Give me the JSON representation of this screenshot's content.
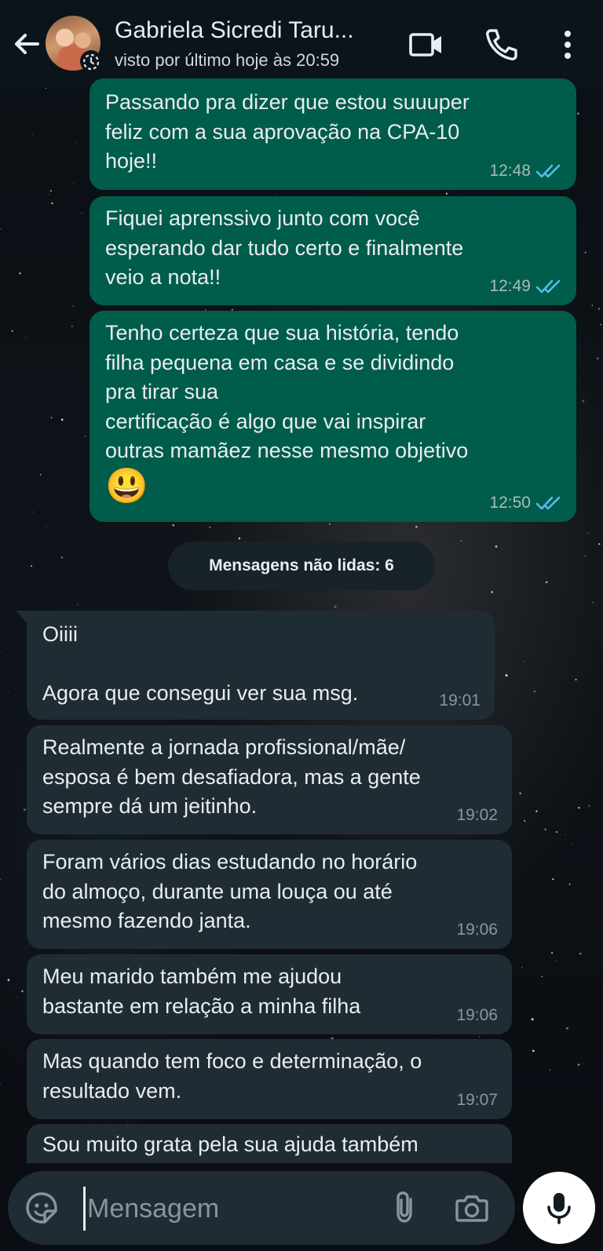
{
  "header": {
    "contact_name": "Gabriela Sicredi Taru...",
    "status": "visto por último hoje às 20:59",
    "icons": [
      "back-arrow-icon",
      "disappearing-timer-icon",
      "video-call-icon",
      "voice-call-icon",
      "more-options-icon"
    ]
  },
  "messages": [
    {
      "direction": "out",
      "text": "Passando pra dizer que estou suuuper\nfeliz com a sua aprovação na CPA-10\nhoje!!",
      "time": "12:48",
      "status": "read"
    },
    {
      "direction": "out",
      "text": "Fiquei aprenssivo junto com você\nesperando dar tudo certo e finalmente\nveio a nota!!",
      "time": "12:49",
      "status": "read"
    },
    {
      "direction": "out",
      "text": "Tenho certeza que sua história, tendo\nfilha pequena em casa e se dividindo\npra tirar sua\ncertificação é algo que vai inspirar\noutras mamãez nesse mesmo objetivo",
      "emoji": "😃",
      "time": "12:50",
      "status": "read"
    },
    {
      "direction": "in",
      "text": "Oiiii\n\nAgora que consegui ver sua msg.",
      "time": "19:01"
    },
    {
      "direction": "in",
      "text": "Realmente a jornada profissional/mãe/\nesposa é bem desafiadora, mas a gente\nsempre dá um jeitinho.",
      "time": "19:02"
    },
    {
      "direction": "in",
      "text": "Foram vários dias estudando no horário\ndo almoço, durante uma louça ou até\nmesmo fazendo janta.",
      "time": "19:06"
    },
    {
      "direction": "in",
      "text": "Meu marido também me ajudou\nbastante em relação a minha filha",
      "time": "19:06"
    },
    {
      "direction": "in",
      "text": "Mas quando tem foco e determinação, o\nresultado vem.",
      "time": "19:07"
    },
    {
      "direction": "in",
      "text": "Sou muito grata pela sua ajuda também"
    }
  ],
  "unread_banner": "Mensagens não lidas: 6",
  "input": {
    "placeholder": "Mensagem",
    "icons": [
      "sticker-icon",
      "attach-icon",
      "camera-icon",
      "microphone-icon"
    ]
  },
  "colors": {
    "outgoing_bubble": "#005c4b",
    "incoming_bubble": "#202c33",
    "header_bg": "#0b141a",
    "read_tick": "#53bdeb",
    "input_bar": "#1f2c34"
  }
}
